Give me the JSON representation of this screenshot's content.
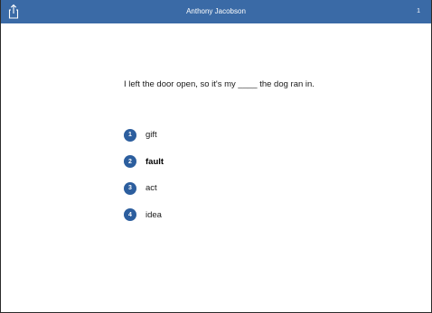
{
  "header": {
    "title": "Anthony Jacobson",
    "count": "1",
    "share_icon": "share-icon",
    "bar_color": "#3a6aa6"
  },
  "question": {
    "text": "I left the door open, so it's my ____ the dog ran in."
  },
  "options": [
    {
      "number": "1",
      "label": "gift"
    },
    {
      "number": "2",
      "label": "fault"
    },
    {
      "number": "3",
      "label": "act"
    },
    {
      "number": "4",
      "label": "idea"
    }
  ],
  "badge_color": "#2c5e9e"
}
